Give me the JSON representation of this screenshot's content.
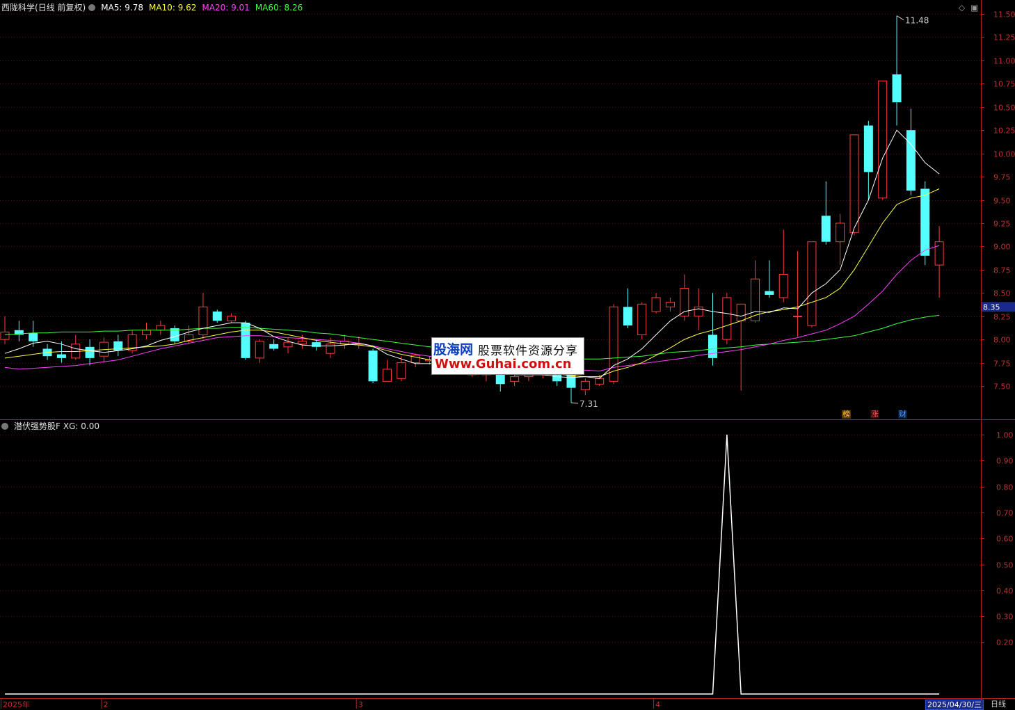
{
  "header": {
    "stock": "西陇科学",
    "mode": "(日线 前复权)",
    "ma5": "MA5: 9.78",
    "ma10": "MA10: 9.62",
    "ma20": "MA20: 9.01",
    "ma60": "MA60: 8.26",
    "colors": {
      "ma5": "#ffffff",
      "ma10": "#ffff40",
      "ma20": "#ff40ff",
      "ma60": "#40ff40"
    }
  },
  "indicator": {
    "title": "潜伏强势股F",
    "value": "XG: 0.00"
  },
  "watermark": {
    "line1a": "股海网",
    "line1b": "股票软件资源分享",
    "line2": "Www.Guhai.com.cn"
  },
  "tags": {
    "date": "2025/04/30/三",
    "period": "日线"
  },
  "badges": [
    {
      "text": "榜",
      "color": "#ffcc00",
      "bg": "#553300"
    },
    {
      "text": "涨",
      "color": "#ff6060",
      "bg": "#330000"
    },
    {
      "text": "财",
      "color": "#60a0ff",
      "bg": "#001a40"
    }
  ],
  "chart_data": [
    {
      "type": "candlestick",
      "title": "西陇科学 (日线 前复权)",
      "ylim": [
        7.25,
        11.6
      ],
      "ticks": [
        "11.50",
        "11.25",
        "11.00",
        "10.75",
        "10.50",
        "10.25",
        "10.00",
        "9.75",
        "9.50",
        "9.25",
        "9.00",
        "8.75",
        "8.50",
        "8.25",
        "8.00",
        "7.75",
        "7.50"
      ],
      "last_price": "8.35",
      "annotations": {
        "high": "11.48",
        "low": "7.31"
      },
      "months": [
        "2025年",
        "2",
        "3",
        "4"
      ],
      "candles": [
        [
          8.0,
          8.08,
          8.25,
          7.95
        ],
        [
          8.1,
          8.05,
          8.2,
          7.98
        ],
        [
          8.07,
          7.98,
          8.2,
          7.92
        ],
        [
          7.9,
          7.82,
          7.95,
          7.78
        ],
        [
          7.84,
          7.8,
          7.98,
          7.75
        ],
        [
          7.8,
          7.95,
          8.05,
          7.78
        ],
        [
          7.92,
          7.8,
          8.0,
          7.72
        ],
        [
          7.82,
          7.97,
          8.02,
          7.75
        ],
        [
          7.98,
          7.88,
          8.05,
          7.82
        ],
        [
          7.88,
          8.05,
          8.1,
          7.85
        ],
        [
          8.05,
          8.1,
          8.18,
          8.0
        ],
        [
          8.1,
          8.15,
          8.2,
          8.05
        ],
        [
          8.12,
          7.98,
          8.15,
          7.95
        ],
        [
          7.98,
          8.05,
          8.15,
          7.95
        ],
        [
          8.05,
          8.35,
          8.5,
          8.0
        ],
        [
          8.3,
          8.2,
          8.32,
          8.18
        ],
        [
          8.2,
          8.25,
          8.28,
          8.18
        ],
        [
          8.18,
          7.8,
          8.2,
          7.78
        ],
        [
          7.8,
          7.98,
          8.0,
          7.75
        ],
        [
          7.95,
          7.9,
          8.0,
          7.88
        ],
        [
          7.92,
          7.97,
          8.02,
          7.85
        ],
        [
          7.95,
          7.98,
          8.05,
          7.9
        ],
        [
          7.97,
          7.92,
          8.0,
          7.88
        ],
        [
          7.85,
          7.95,
          8.02,
          7.8
        ],
        [
          7.95,
          7.98,
          8.05,
          7.9
        ],
        [
          7.95,
          7.95,
          8.03,
          7.9
        ],
        [
          7.88,
          7.55,
          7.9,
          7.53
        ],
        [
          7.55,
          7.68,
          7.78,
          7.55
        ],
        [
          7.58,
          7.75,
          7.82,
          7.55
        ],
        [
          7.75,
          7.83,
          7.85,
          7.7
        ],
        [
          7.77,
          7.78,
          7.82,
          7.73
        ],
        [
          7.78,
          7.7,
          7.8,
          7.65
        ],
        [
          7.7,
          7.73,
          7.8,
          7.65
        ],
        [
          7.62,
          7.68,
          7.75,
          7.6
        ],
        [
          7.62,
          7.65,
          7.72,
          7.55
        ],
        [
          7.66,
          7.52,
          7.68,
          7.44
        ],
        [
          7.55,
          7.6,
          7.7,
          7.5
        ],
        [
          7.6,
          7.62,
          7.65,
          7.55
        ],
        [
          7.62,
          7.64,
          7.66,
          7.58
        ],
        [
          7.64,
          7.55,
          7.66,
          7.5
        ],
        [
          7.64,
          7.48,
          7.66,
          7.32
        ],
        [
          7.46,
          7.55,
          7.58,
          7.4
        ],
        [
          7.52,
          7.58,
          7.62,
          7.5
        ],
        [
          7.55,
          8.35,
          8.38,
          7.52
        ],
        [
          8.35,
          8.15,
          8.55,
          8.12
        ],
        [
          8.05,
          8.38,
          8.4,
          8.0
        ],
        [
          8.3,
          8.45,
          8.5,
          8.28
        ],
        [
          8.35,
          8.4,
          8.45,
          8.3
        ],
        [
          8.25,
          8.55,
          8.7,
          8.2
        ],
        [
          8.25,
          8.35,
          8.55,
          8.1
        ],
        [
          8.05,
          7.8,
          8.5,
          7.72
        ],
        [
          8.0,
          8.45,
          8.5,
          7.95
        ],
        [
          8.2,
          8.38,
          8.38,
          7.45
        ],
        [
          8.2,
          8.65,
          8.85,
          8.18
        ],
        [
          8.52,
          8.48,
          8.85,
          8.45
        ],
        [
          8.45,
          8.7,
          9.18,
          8.4
        ],
        [
          8.25,
          8.25,
          8.95,
          8.03
        ],
        [
          8.15,
          9.05,
          9.05,
          8.13
        ],
        [
          9.33,
          9.05,
          9.7,
          9.02
        ],
        [
          9.05,
          9.25,
          9.35,
          8.8
        ],
        [
          9.15,
          10.2,
          10.2,
          9.12
        ],
        [
          10.3,
          9.8,
          10.35,
          9.5
        ],
        [
          9.52,
          10.78,
          10.78,
          9.5
        ],
        [
          10.85,
          10.55,
          11.48,
          10.3
        ],
        [
          10.25,
          9.6,
          10.48,
          9.55
        ],
        [
          9.62,
          8.9,
          9.7,
          8.8
        ],
        [
          8.8,
          9.05,
          9.22,
          8.45
        ]
      ],
      "ma5": [
        7.85,
        7.9,
        7.96,
        7.98,
        7.95,
        7.9,
        7.88,
        7.86,
        7.88,
        7.9,
        7.93,
        7.99,
        8.03,
        8.08,
        8.12,
        8.15,
        8.18,
        8.18,
        8.12,
        8.03,
        7.98,
        7.94,
        7.93,
        7.93,
        7.94,
        7.96,
        7.93,
        7.84,
        7.79,
        7.74,
        7.74,
        7.75,
        7.74,
        7.72,
        7.7,
        7.68,
        7.62,
        7.62,
        7.62,
        7.6,
        7.59,
        7.6,
        7.58,
        7.72,
        7.79,
        7.9,
        8.05,
        8.2,
        8.3,
        8.33,
        8.3,
        8.28,
        8.25,
        8.3,
        8.29,
        8.34,
        8.33,
        8.5,
        8.6,
        8.75,
        9.2,
        9.5,
        9.95,
        10.25,
        10.1,
        9.9,
        9.78
      ],
      "ma10": [
        7.8,
        7.82,
        7.84,
        7.86,
        7.87,
        7.87,
        7.88,
        7.89,
        7.9,
        7.91,
        7.92,
        7.93,
        7.95,
        7.99,
        8.02,
        8.05,
        8.08,
        8.1,
        8.1,
        8.08,
        8.05,
        8.02,
        7.99,
        7.97,
        7.95,
        7.94,
        7.92,
        7.88,
        7.84,
        7.81,
        7.78,
        7.75,
        7.73,
        7.72,
        7.7,
        7.68,
        7.67,
        7.66,
        7.64,
        7.63,
        7.61,
        7.6,
        7.6,
        7.66,
        7.7,
        7.75,
        7.83,
        7.91,
        8.0,
        8.06,
        8.1,
        8.15,
        8.2,
        8.26,
        8.3,
        8.32,
        8.35,
        8.4,
        8.45,
        8.55,
        8.75,
        9.0,
        9.25,
        9.45,
        9.52,
        9.55,
        9.62
      ],
      "ma20": [
        7.7,
        7.68,
        7.69,
        7.7,
        7.71,
        7.72,
        7.74,
        7.76,
        7.78,
        7.82,
        7.86,
        7.9,
        7.93,
        7.96,
        7.99,
        8.02,
        8.03,
        8.04,
        8.04,
        8.03,
        8.02,
        8.01,
        8.0,
        7.99,
        7.98,
        7.96,
        7.93,
        7.9,
        7.87,
        7.84,
        7.82,
        7.8,
        7.78,
        7.76,
        7.74,
        7.72,
        7.71,
        7.7,
        7.69,
        7.68,
        7.67,
        7.67,
        7.66,
        7.7,
        7.72,
        7.74,
        7.76,
        7.78,
        7.8,
        7.83,
        7.85,
        7.87,
        7.89,
        7.92,
        7.95,
        7.99,
        8.02,
        8.06,
        8.1,
        8.17,
        8.25,
        8.38,
        8.52,
        8.7,
        8.85,
        8.96,
        9.01
      ],
      "ma60": [
        8.05,
        8.06,
        8.07,
        8.07,
        8.08,
        8.08,
        8.08,
        8.09,
        8.09,
        8.1,
        8.1,
        8.1,
        8.1,
        8.11,
        8.12,
        8.12,
        8.13,
        8.13,
        8.12,
        8.11,
        8.1,
        8.09,
        8.07,
        8.06,
        8.04,
        8.02,
        8.0,
        7.98,
        7.96,
        7.94,
        7.92,
        7.9,
        7.88,
        7.86,
        7.85,
        7.84,
        7.83,
        7.82,
        7.81,
        7.8,
        7.79,
        7.79,
        7.79,
        7.8,
        7.81,
        7.82,
        7.84,
        7.86,
        7.87,
        7.88,
        7.9,
        7.91,
        7.92,
        7.94,
        7.95,
        7.96,
        7.97,
        7.98,
        8.0,
        8.02,
        8.04,
        8.08,
        8.12,
        8.17,
        8.21,
        8.24,
        8.26
      ]
    },
    {
      "type": "line",
      "title": "潜伏强势股F",
      "ylim": [
        0,
        1.0
      ],
      "ticks": [
        "1.00",
        "0.90",
        "0.80",
        "0.70",
        "0.60",
        "0.50",
        "0.40",
        "0.30",
        "0.20"
      ],
      "values": [
        0,
        0,
        0,
        0,
        0,
        0,
        0,
        0,
        0,
        0,
        0,
        0,
        0,
        0,
        0,
        0,
        0,
        0,
        0,
        0,
        0,
        0,
        0,
        0,
        0,
        0,
        0,
        0,
        0,
        0,
        0,
        0,
        0,
        0,
        0,
        0,
        0,
        0,
        0,
        0,
        0,
        0,
        0,
        0,
        0,
        0,
        0,
        0,
        0,
        0,
        0,
        1,
        0,
        0,
        0,
        0,
        0,
        0,
        0,
        0,
        0,
        0,
        0,
        0,
        0,
        0,
        0
      ]
    }
  ]
}
